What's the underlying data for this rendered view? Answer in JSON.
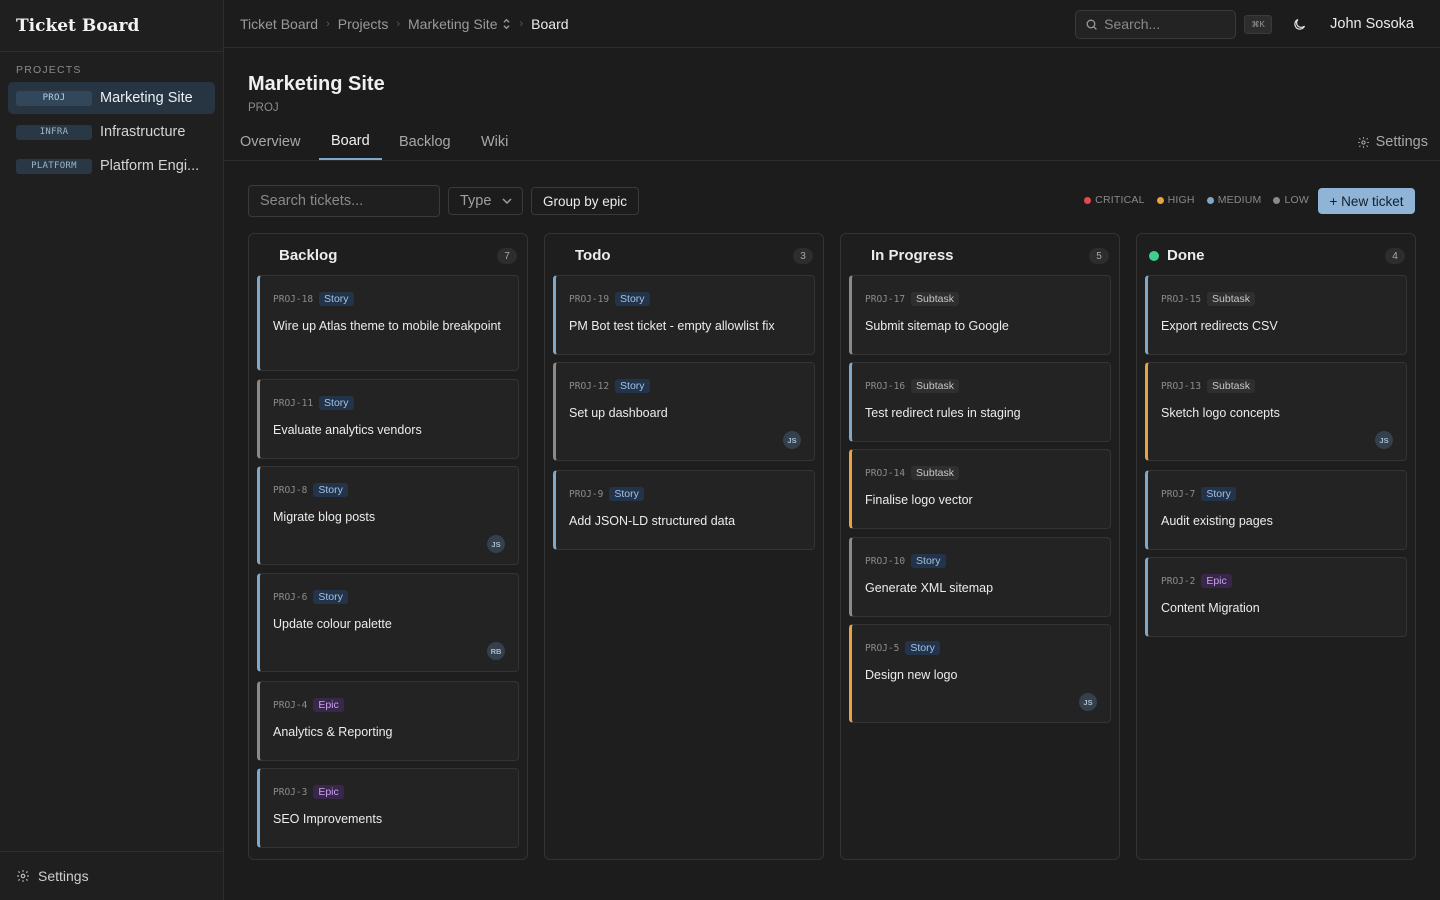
{
  "app": {
    "title": "Ticket Board"
  },
  "sidebar": {
    "heading": "PROJECTS",
    "items": [
      {
        "key": "PROJ",
        "name": "Marketing Site"
      },
      {
        "key": "INFRA",
        "name": "Infrastructure"
      },
      {
        "key": "PLATFORM",
        "name": "Platform Engi..."
      }
    ],
    "settings_label": "Settings"
  },
  "topbar": {
    "breadcrumb": [
      "Ticket Board",
      "Projects",
      "Marketing Site",
      "Board"
    ],
    "search_placeholder": "Search...",
    "shortcut": "⌘K",
    "user": "John Sosoka"
  },
  "project": {
    "title": "Marketing Site",
    "key": "PROJ",
    "tabs": [
      "Overview",
      "Board",
      "Backlog",
      "Wiki"
    ],
    "settings_label": "Settings"
  },
  "toolbar": {
    "search_placeholder": "Search tickets...",
    "type_label": "Type",
    "group_label": "Group by epic",
    "new_ticket_label": "+ New ticket",
    "legend": [
      {
        "label": "CRITICAL",
        "color": "#e5484d"
      },
      {
        "label": "HIGH",
        "color": "#e6a243"
      },
      {
        "label": "MEDIUM",
        "color": "#7fa8c9"
      },
      {
        "label": "LOW",
        "color": "#8a8a8a"
      }
    ]
  },
  "colors": {
    "accent": "#8fb4d6",
    "priority_medium": "#7fa8c9",
    "priority_high": "#e6a243",
    "priority_low": "#8a8a8a",
    "done_dot": "#3ecf8e"
  },
  "columns": [
    {
      "title": "Backlog",
      "count": "7",
      "cards": [
        {
          "id": "PROJ-18",
          "type": "Story",
          "title": "Wire up Atlas theme to mobile breakpoint",
          "priority": "medium",
          "avatar": ""
        },
        {
          "id": "PROJ-11",
          "type": "Story",
          "title": "Evaluate analytics vendors",
          "priority": "low",
          "avatar": ""
        },
        {
          "id": "PROJ-8",
          "type": "Story",
          "title": "Migrate blog posts",
          "priority": "medium",
          "avatar": "JS"
        },
        {
          "id": "PROJ-6",
          "type": "Story",
          "title": "Update colour palette",
          "priority": "medium",
          "avatar": "RB"
        },
        {
          "id": "PROJ-4",
          "type": "Epic",
          "title": "Analytics & Reporting",
          "priority": "low",
          "avatar": ""
        },
        {
          "id": "PROJ-3",
          "type": "Epic",
          "title": "SEO Improvements",
          "priority": "medium",
          "avatar": ""
        }
      ]
    },
    {
      "title": "Todo",
      "count": "3",
      "cards": [
        {
          "id": "PROJ-19",
          "type": "Story",
          "title": "PM Bot test ticket - empty allowlist fix",
          "priority": "medium",
          "avatar": ""
        },
        {
          "id": "PROJ-12",
          "type": "Story",
          "title": "Set up dashboard",
          "priority": "low",
          "avatar": "JS"
        },
        {
          "id": "PROJ-9",
          "type": "Story",
          "title": "Add JSON-LD structured data",
          "priority": "medium",
          "avatar": ""
        }
      ]
    },
    {
      "title": "In Progress",
      "count": "5",
      "cards": [
        {
          "id": "PROJ-17",
          "type": "Subtask",
          "title": "Submit sitemap to Google",
          "priority": "low",
          "avatar": ""
        },
        {
          "id": "PROJ-16",
          "type": "Subtask",
          "title": "Test redirect rules in staging",
          "priority": "medium",
          "avatar": ""
        },
        {
          "id": "PROJ-14",
          "type": "Subtask",
          "title": "Finalise logo vector",
          "priority": "high",
          "avatar": ""
        },
        {
          "id": "PROJ-10",
          "type": "Story",
          "title": "Generate XML sitemap",
          "priority": "low",
          "avatar": ""
        },
        {
          "id": "PROJ-5",
          "type": "Story",
          "title": "Design new logo",
          "priority": "high",
          "avatar": "JS"
        }
      ]
    },
    {
      "title": "Done",
      "count": "4",
      "cards": [
        {
          "id": "PROJ-15",
          "type": "Subtask",
          "title": "Export redirects CSV",
          "priority": "medium",
          "avatar": ""
        },
        {
          "id": "PROJ-13",
          "type": "Subtask",
          "title": "Sketch logo concepts",
          "priority": "high",
          "avatar": "JS"
        },
        {
          "id": "PROJ-7",
          "type": "Story",
          "title": "Audit existing pages",
          "priority": "medium",
          "avatar": ""
        },
        {
          "id": "PROJ-2",
          "type": "Epic",
          "title": "Content Migration",
          "priority": "medium",
          "avatar": ""
        }
      ]
    }
  ]
}
